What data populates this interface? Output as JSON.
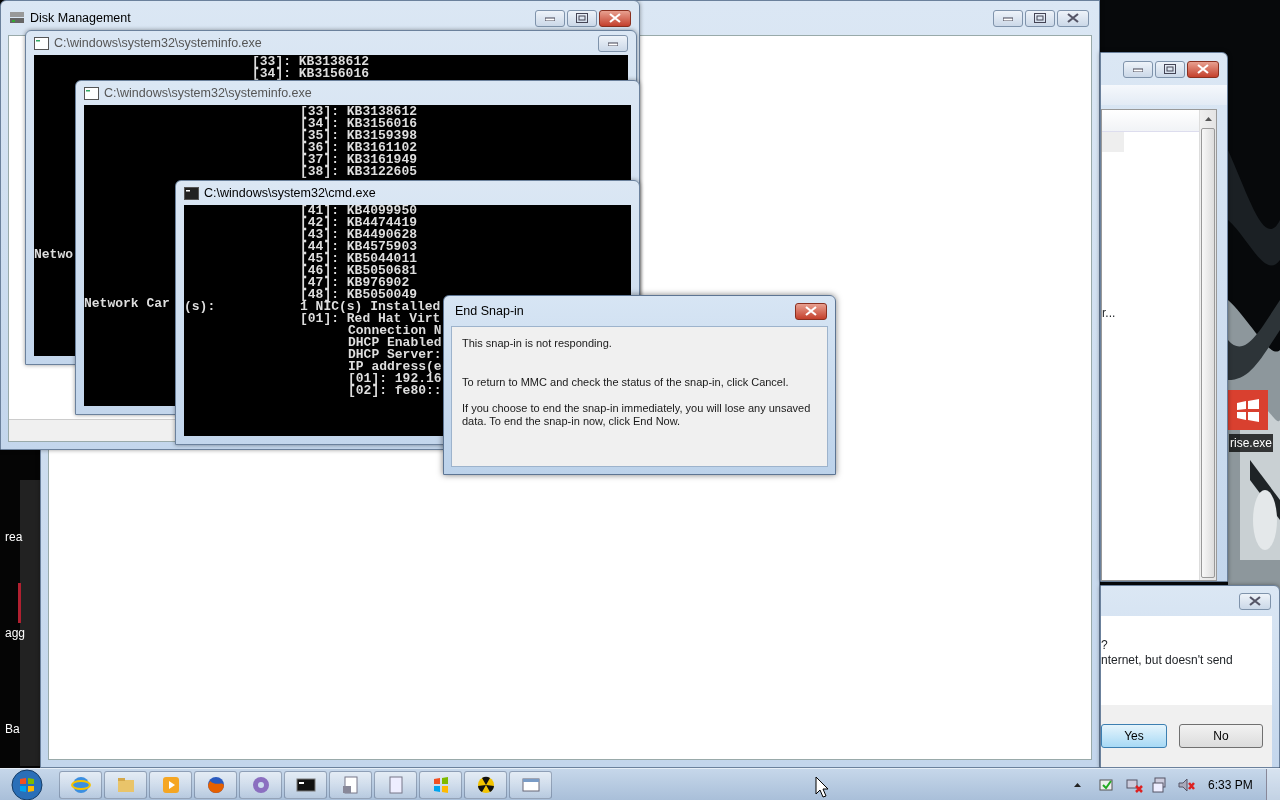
{
  "back_window": {
    "list_text": "r..."
  },
  "right_dialog": {
    "lines": [
      "?",
      "nternet, but doesn't send"
    ],
    "buttons": [
      {
        "label": "Yes",
        "selected": true
      },
      {
        "label": "No",
        "selected": false
      }
    ]
  },
  "desktop": {
    "icon_label": "rise.exe",
    "side_labels": [
      "rea",
      "agg",
      "Ba"
    ]
  },
  "disk_management": {
    "title": "Disk Management"
  },
  "consoles": [
    {
      "title": "C:\\windows\\system32\\systeminfo.exe",
      "lines": [
        {
          "kind": "entry",
          "text": "[33]: KB3138612"
        },
        {
          "kind": "entry",
          "text": "[34]: KB3156016"
        }
      ],
      "footer_lines": [
        {
          "kind": "label",
          "text": "Netwo"
        }
      ]
    },
    {
      "title": "C:\\windows\\system32\\systeminfo.exe",
      "lines": [
        {
          "kind": "entry",
          "text": "[33]: KB3138612"
        },
        {
          "kind": "entry",
          "text": "[34]: KB3156016"
        },
        {
          "kind": "entry",
          "text": "[35]: KB3159398"
        },
        {
          "kind": "entry",
          "text": "[36]: KB3161102"
        },
        {
          "kind": "entry",
          "text": "[37]: KB3161949"
        },
        {
          "kind": "entry",
          "text": "[38]: KB3122605"
        }
      ],
      "footer_lines": [
        {
          "kind": "label",
          "text": "Network Car"
        }
      ]
    },
    {
      "title": "C:\\windows\\system32\\cmd.exe",
      "lines": [
        {
          "kind": "entry",
          "text": "[41]: KB4099950"
        },
        {
          "kind": "entry",
          "text": "[42]: KB4474419"
        },
        {
          "kind": "entry",
          "text": "[43]: KB4490628"
        },
        {
          "kind": "entry",
          "text": "[44]: KB4575903"
        },
        {
          "kind": "entry",
          "text": "[45]: KB5044011"
        },
        {
          "kind": "entry",
          "text": "[46]: KB5050681"
        },
        {
          "kind": "entry",
          "text": "[47]: KB976902"
        },
        {
          "kind": "entry",
          "text": "[48]: KB5050049"
        },
        {
          "kind": "entry",
          "label": "(s):",
          "text": "1 NIC(s) Installed"
        },
        {
          "kind": "entry",
          "text": "[01]: Red Hat Virt"
        },
        {
          "kind": "detail",
          "text": "Connection N"
        },
        {
          "kind": "detail",
          "text": "DHCP Enabled"
        },
        {
          "kind": "detail",
          "text": "DHCP Server:"
        },
        {
          "kind": "detail",
          "text": "IP address(e"
        },
        {
          "kind": "detail",
          "text": "[01]: 192.16"
        },
        {
          "kind": "detail",
          "text": "[02]: fe80::"
        }
      ]
    }
  ],
  "dialog": {
    "title": "End Snap-in",
    "paragraphs": [
      "This snap-in is not responding.",
      "To return to MMC and check the status of the snap-in, click Cancel.",
      "If you choose to end the snap-in immediately, you will lose any unsaved data.  To end the snap-in now, click End Now."
    ]
  },
  "taskbar": {
    "clock": "6:33 PM"
  }
}
